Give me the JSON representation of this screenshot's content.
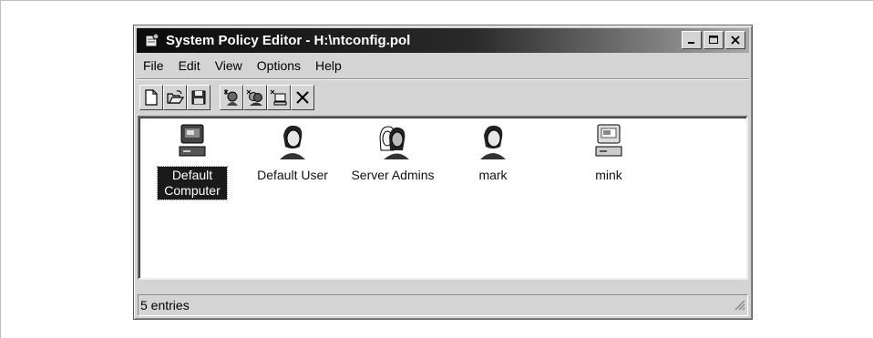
{
  "window": {
    "title": "System Policy Editor - H:\\ntconfig.pol",
    "title_icon": "policy-editor-icon",
    "controls": [
      "minimize-icon",
      "maximize-icon",
      "close-icon"
    ]
  },
  "menu": [
    "File",
    "Edit",
    "View",
    "Options",
    "Help"
  ],
  "toolbar": {
    "buttons": [
      "new-document-icon",
      "open-folder-icon",
      "save-disk-icon",
      "add-user-icon",
      "add-group-icon",
      "add-computer-icon",
      "remove-x-icon"
    ]
  },
  "entries": [
    {
      "label_line1": "Default",
      "label_line2": "Computer",
      "icon": "computer-icon",
      "selected": true
    },
    {
      "label": "Default User",
      "icon": "user-icon",
      "selected": false
    },
    {
      "label": "Server Admins",
      "icon": "group-icon",
      "selected": false
    },
    {
      "label": "mark",
      "icon": "user-icon",
      "selected": false
    },
    {
      "label": "mink",
      "icon": "computer-icon",
      "selected": false
    }
  ],
  "status": {
    "text": "5 entries"
  },
  "colors": {
    "selection": "#1a1a1a",
    "window_face": "#d4d4d4",
    "titlebar_dark": "#0c0c0c"
  }
}
